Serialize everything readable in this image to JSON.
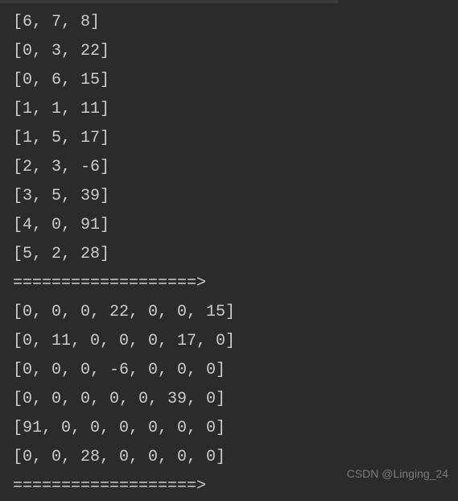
{
  "lines": [
    "[6, 7, 8]",
    "[0, 3, 22]",
    "[0, 6, 15]",
    "[1, 1, 11]",
    "[1, 5, 17]",
    "[2, 3, -6]",
    "[3, 5, 39]",
    "[4, 0, 91]",
    "[5, 2, 28]",
    "===================>",
    "[0, 0, 0, 22, 0, 0, 15]",
    "[0, 11, 0, 0, 0, 17, 0]",
    "[0, 0, 0, -6, 0, 0, 0]",
    "[0, 0, 0, 0, 0, 39, 0]",
    "[91, 0, 0, 0, 0, 0, 0]",
    "[0, 0, 28, 0, 0, 0, 0]",
    "===================>"
  ],
  "watermark": "CSDN @Linging_24"
}
